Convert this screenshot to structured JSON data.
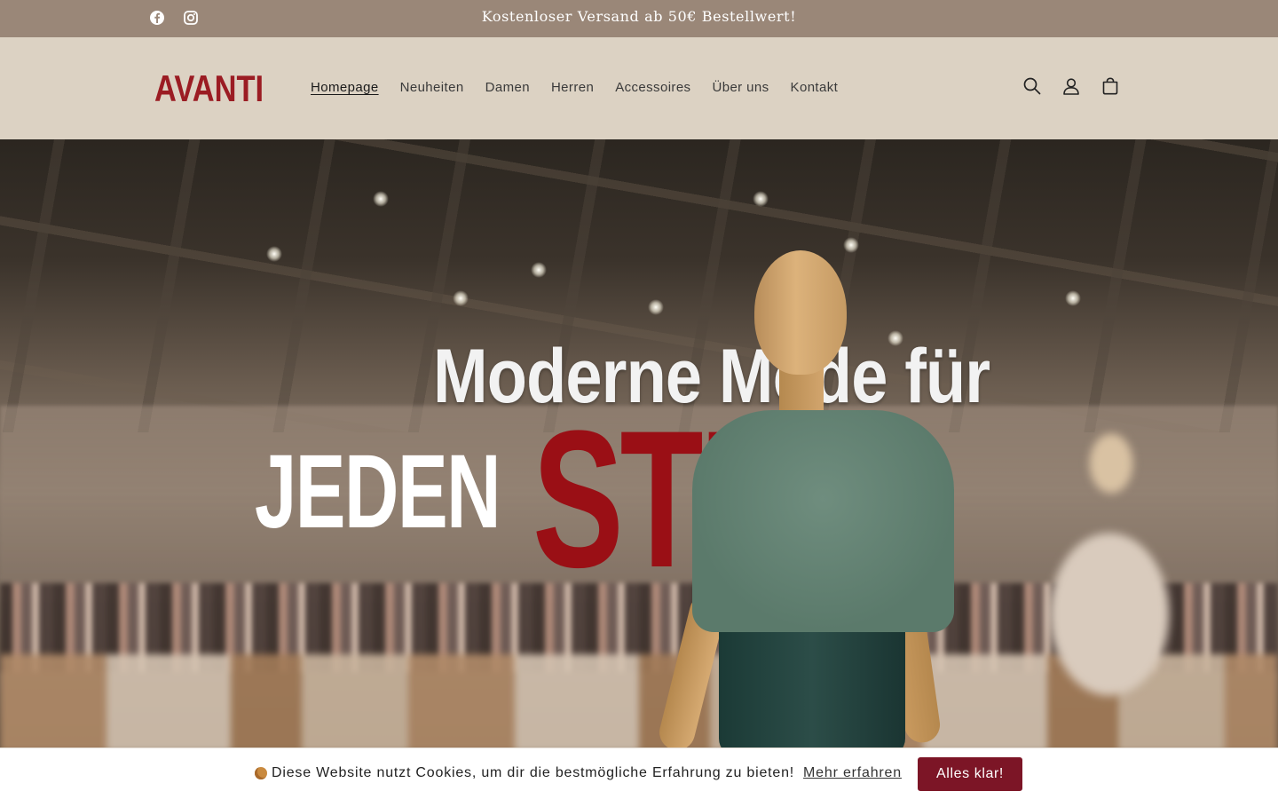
{
  "announcement": {
    "message": "Kostenloser Versand ab 50€ Bestellwert!",
    "socials": [
      {
        "icon": "facebook-icon"
      },
      {
        "icon": "instagram-icon"
      }
    ]
  },
  "header": {
    "logo_text": "AVANTI",
    "nav": [
      {
        "label": "Homepage",
        "active": true
      },
      {
        "label": "Neuheiten",
        "active": false
      },
      {
        "label": "Damen",
        "active": false
      },
      {
        "label": "Herren",
        "active": false
      },
      {
        "label": "Accessoires",
        "active": false
      },
      {
        "label": "Über uns",
        "active": false
      },
      {
        "label": "Kontakt",
        "active": false
      }
    ],
    "icons": [
      "search-icon",
      "account-icon",
      "cart-icon"
    ]
  },
  "hero": {
    "line1": "Moderne Mode für",
    "line2_a": "JEDEN",
    "line2_b": "STIL"
  },
  "cookie_banner": {
    "text": "Diese Website nutzt Cookies, um dir die bestmögliche Erfahrung zu bieten!",
    "link": "Mehr erfahren",
    "button": "Alles klar!"
  },
  "colors": {
    "announcement_bg": "#9a8778",
    "header_bg": "#dcd2c3",
    "brand_red": "#9b1c23",
    "button_bg": "#7c1526"
  }
}
